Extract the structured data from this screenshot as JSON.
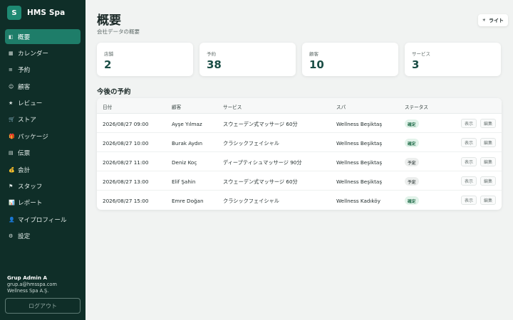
{
  "brand": {
    "logo_letter": "S",
    "name": "HMS Spa",
    "accent": "#1e8a73"
  },
  "nav": [
    {
      "icon": "dashboard-icon",
      "glyph": "◧",
      "label": "概要",
      "active": true
    },
    {
      "icon": "calendar-icon",
      "glyph": "▦",
      "label": "カレンダー",
      "active": false
    },
    {
      "icon": "list-icon",
      "glyph": "≡",
      "label": "予約",
      "active": false
    },
    {
      "icon": "customers-icon",
      "glyph": "☺",
      "label": "顧客",
      "active": false
    },
    {
      "icon": "star-icon",
      "glyph": "★",
      "label": "レビュー",
      "active": false
    },
    {
      "icon": "cart-icon",
      "glyph": "🛒",
      "label": "ストア",
      "active": false
    },
    {
      "icon": "gift-icon",
      "glyph": "🎁",
      "label": "パッケージ",
      "active": false
    },
    {
      "icon": "receipt-icon",
      "glyph": "▤",
      "label": "伝票",
      "active": false
    },
    {
      "icon": "money-bag-icon",
      "glyph": "💰",
      "label": "会計",
      "active": false
    },
    {
      "icon": "flag-icon",
      "glyph": "⚑",
      "label": "スタッフ",
      "active": false
    },
    {
      "icon": "chart-icon",
      "glyph": "📊",
      "label": "レポート",
      "active": false
    },
    {
      "icon": "user-icon",
      "glyph": "👤",
      "label": "マイプロフィール",
      "active": false
    },
    {
      "icon": "gear-icon",
      "glyph": "⚙",
      "label": "設定",
      "active": false
    }
  ],
  "user": {
    "name": "Grup Admin A",
    "email": "grup.a@hmsspa.com",
    "company": "Wellness Spa A.Ş.",
    "logout_label": "ログアウト"
  },
  "header": {
    "title": "概要",
    "subtitle": "会社データの概要",
    "theme_label": "ライト",
    "theme_glyph": "☀"
  },
  "stats": [
    {
      "label": "店舗",
      "value": "2"
    },
    {
      "label": "予約",
      "value": "38"
    },
    {
      "label": "顧客",
      "value": "10"
    },
    {
      "label": "サービス",
      "value": "3"
    }
  ],
  "upcoming": {
    "title": "今後の予約",
    "columns": [
      "日付",
      "顧客",
      "サービス",
      "スパ",
      "ステータス"
    ],
    "view_label": "表示",
    "edit_label": "編集",
    "rows": [
      {
        "date": "2026/08/27 09:00",
        "customer": "Ayşe Yılmaz",
        "service": "スウェーデン式マッサージ 60分",
        "spa": "Wellness Beşiktaş",
        "status": "確定",
        "status_type": "confirmed"
      },
      {
        "date": "2026/08/27 10:00",
        "customer": "Burak Aydın",
        "service": "クラシックフェイシャル",
        "spa": "Wellness Beşiktaş",
        "status": "確定",
        "status_type": "confirmed"
      },
      {
        "date": "2026/08/27 11:00",
        "customer": "Deniz Koç",
        "service": "ディープティシュマッサージ 90分",
        "spa": "Wellness Beşiktaş",
        "status": "予定",
        "status_type": "planned"
      },
      {
        "date": "2026/08/27 13:00",
        "customer": "Elif Şahin",
        "service": "スウェーデン式マッサージ 60分",
        "spa": "Wellness Beşiktaş",
        "status": "予定",
        "status_type": "planned"
      },
      {
        "date": "2026/08/27 15:00",
        "customer": "Emre Doğan",
        "service": "クラシックフェイシャル",
        "spa": "Wellness Kadıköy",
        "status": "確定",
        "status_type": "confirmed"
      }
    ]
  }
}
